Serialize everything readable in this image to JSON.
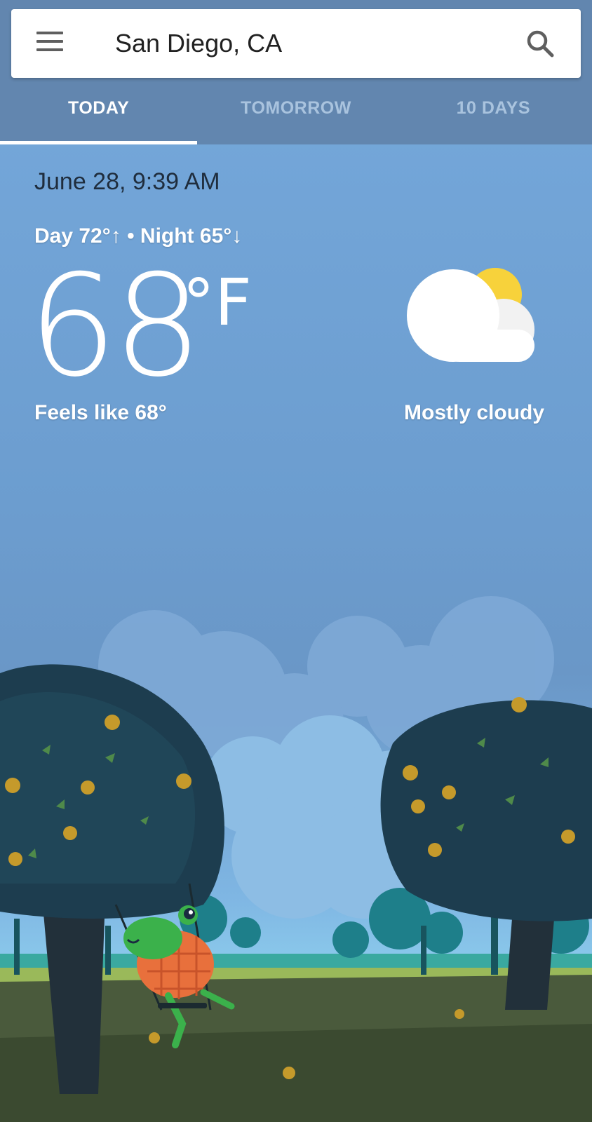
{
  "search": {
    "location": "San Diego, CA"
  },
  "tabs": [
    {
      "label": "TODAY",
      "active": true
    },
    {
      "label": "TOMORROW",
      "active": false
    },
    {
      "label": "10 DAYS",
      "active": false
    }
  ],
  "weather": {
    "datetime": "June 28, 9:39 AM",
    "day_night": "Day 72°↑ • Night 65°↓",
    "temperature": "68",
    "unit": "°F",
    "feels_like": "Feels like 68°",
    "condition": "Mostly cloudy",
    "condition_icon": "partly-cloudy-icon"
  },
  "colors": {
    "header": "#6286af",
    "sky": "#76a9dc",
    "sun": "#f7d23b"
  }
}
